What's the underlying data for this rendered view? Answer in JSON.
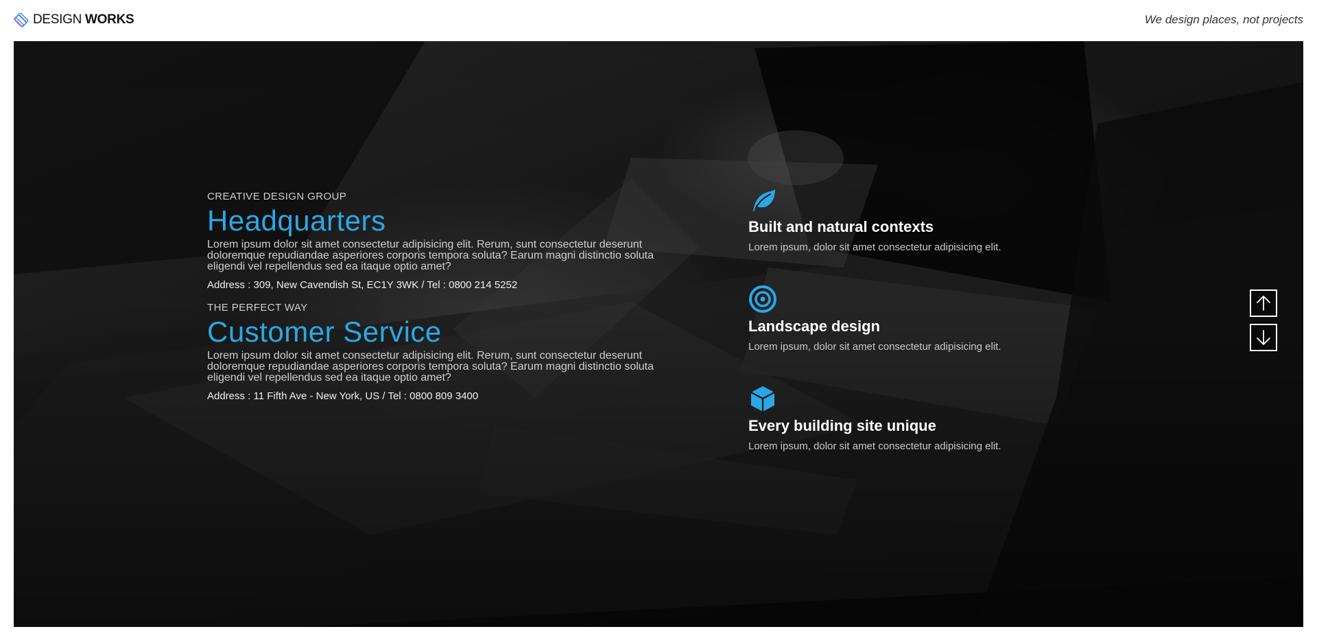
{
  "header": {
    "brand_light": "DESIGN",
    "brand_bold": "WORKS",
    "tagline": "We design places, not projects"
  },
  "colors": {
    "accent": "#2aa8e6",
    "hero_bg": "#141414",
    "text_light": "#ffffff"
  },
  "hero": {
    "locations": [
      {
        "kicker": "CREATIVE DESIGN GROUP",
        "title": "Headquarters",
        "body": "Lorem ipsum dolor sit amet consectetur adipisicing elit. Rerum, sunt consectetur deserunt doloremque repudiandae asperiores corporis tempora soluta? Earum magni distinctio soluta eligendi vel repellendus sed ea itaque optio amet?",
        "address": "Address : 309, New Cavendish St, EC1Y 3WK / Tel : 0800 214 5252"
      },
      {
        "kicker": "THE PERFECT WAY",
        "title": "Customer Service",
        "body": "Lorem ipsum dolor sit amet consectetur adipisicing elit. Rerum, sunt consectetur deserunt doloremque repudiandae asperiores corporis tempora soluta? Earum magni distinctio soluta eligendi vel repellendus sed ea itaque optio amet?",
        "address": "Address : 11 Fifth Ave - New York, US / Tel : 0800 809 3400"
      }
    ],
    "features": [
      {
        "icon": "leaf-icon",
        "title": "Built and natural contexts",
        "desc": "Lorem ipsum, dolor sit amet consectetur adipisicing elit."
      },
      {
        "icon": "target-icon",
        "title": "Landscape design",
        "desc": "Lorem ipsum, dolor sit amet consectetur adipisicing elit."
      },
      {
        "icon": "cube-icon",
        "title": "Every building site unique",
        "desc": "Lorem ipsum, dolor sit amet consectetur adipisicing elit."
      }
    ],
    "nav": {
      "up_icon": "arrow-up-icon",
      "down_icon": "arrow-down-icon"
    }
  }
}
